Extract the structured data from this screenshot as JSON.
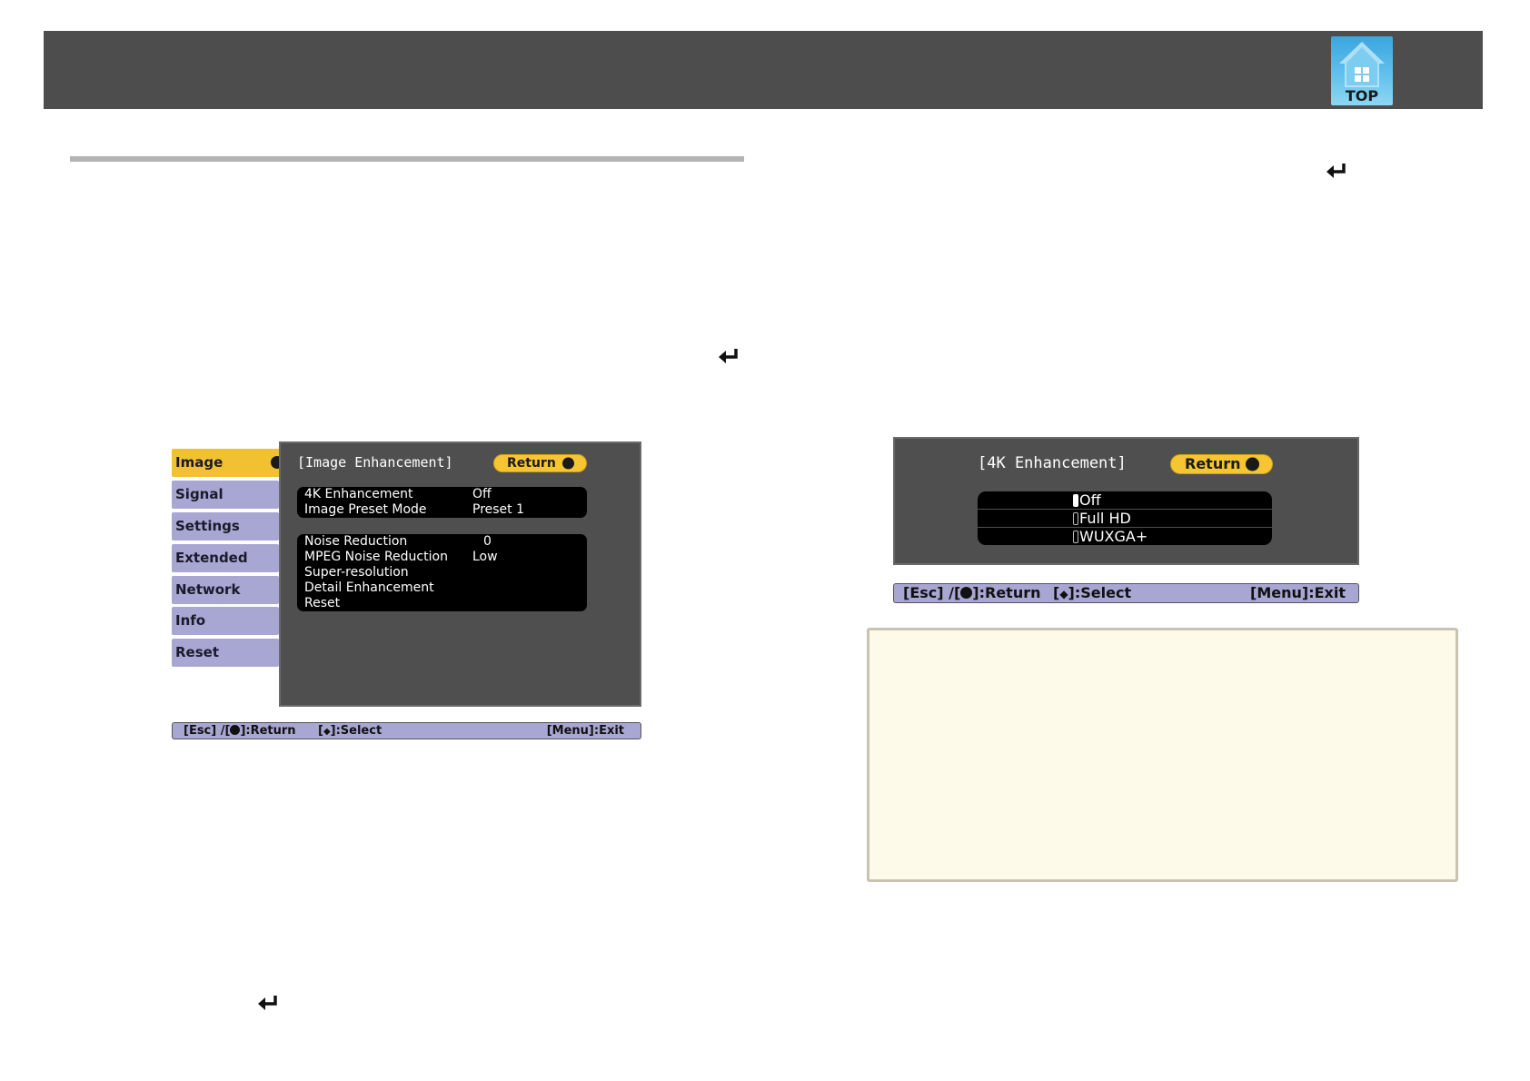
{
  "header": {
    "top_label": "TOP"
  },
  "icons": {
    "home_icon": "home-icon",
    "enter_icon": "enter-key-icon"
  },
  "menu1": {
    "tabs": [
      {
        "label": "Image",
        "active": true
      },
      {
        "label": "Signal"
      },
      {
        "label": "Settings"
      },
      {
        "label": "Extended"
      },
      {
        "label": "Network"
      },
      {
        "label": "Info"
      },
      {
        "label": "Reset"
      }
    ],
    "panel_title": "[Image Enhancement]",
    "return_label": "Return",
    "group1": [
      {
        "label": "4K Enhancement",
        "value": "Off"
      },
      {
        "label": "Image Preset Mode",
        "value": "Preset 1"
      }
    ],
    "group2": [
      {
        "label": "Noise Reduction",
        "value": "0"
      },
      {
        "label": "MPEG Noise Reduction",
        "value": "Low"
      },
      {
        "label": "Super-resolution",
        "value": ""
      },
      {
        "label": "Detail Enhancement",
        "value": ""
      },
      {
        "label": "Reset",
        "value": ""
      }
    ],
    "status": {
      "esc": "[Esc] /[",
      "return": "]:Return",
      "select_open": "[",
      "select": "]:Select",
      "exit": "[Menu]:Exit"
    }
  },
  "menu2": {
    "panel_title": "[4K Enhancement]",
    "return_label": "Return",
    "options": [
      {
        "label": "Off",
        "selected": true
      },
      {
        "label": "Full HD",
        "selected": false
      },
      {
        "label": "WUXGA+",
        "selected": false
      }
    ],
    "status": {
      "esc": "[Esc] /[",
      "return": "]:Return",
      "select_open": "[",
      "select": "]:Select",
      "exit": "[Menu]:Exit"
    }
  },
  "colors": {
    "header_band": "#4d4d4d",
    "tab_active": "#f1c132",
    "tab_inactive": "#a8a6d3",
    "osd_panel": "#4f4f4f",
    "note_box": "#fefaea"
  }
}
